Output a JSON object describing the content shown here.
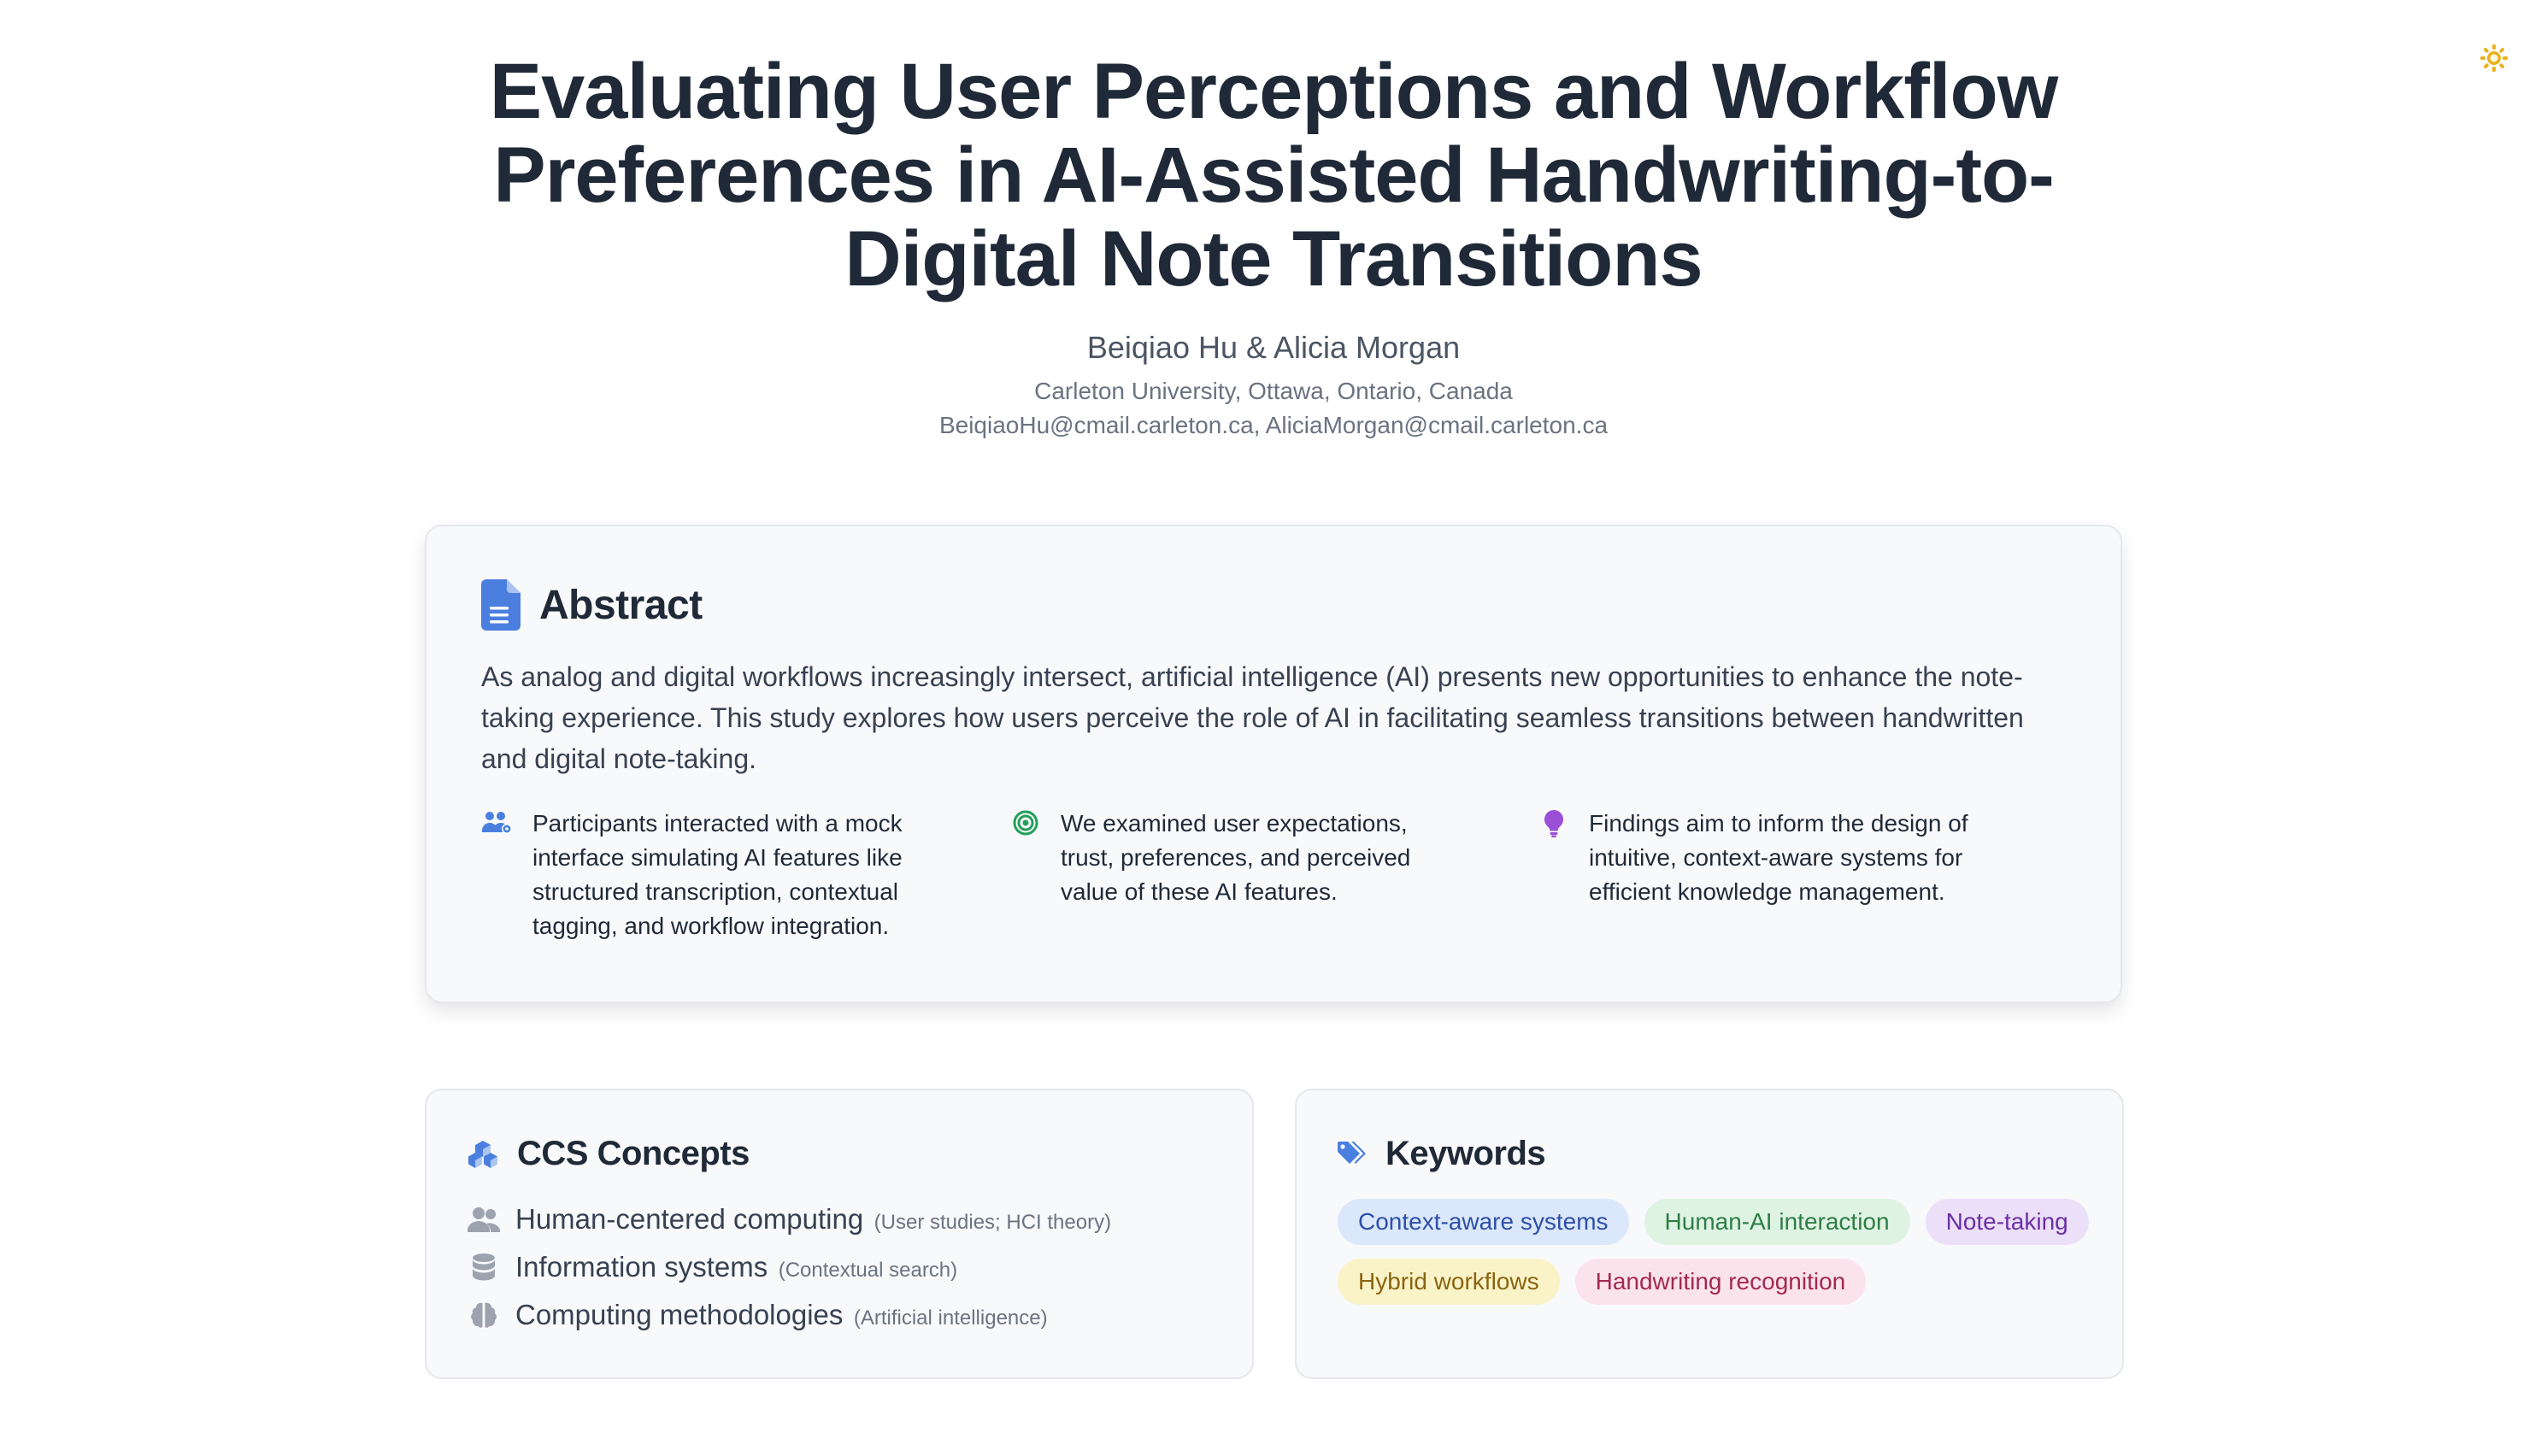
{
  "colors": {
    "accent_blue": "#4a7fe0",
    "accent_green": "#22a05a",
    "accent_purple": "#9b4fd6",
    "sun_yellow": "#e7b21d",
    "icon_gray": "#9ca3af"
  },
  "theme_toggle": {
    "icon": "sun-icon"
  },
  "header": {
    "title": "Evaluating User Perceptions and Workflow Preferences in AI-Assisted Handwriting-to-Digital Note Transitions",
    "authors": "Beiqiao Hu & Alicia Morgan",
    "affiliation": "Carleton University, Ottawa, Ontario, Canada",
    "emails": "BeiqiaoHu@cmail.carleton.ca, AliciaMorgan@cmail.carleton.ca"
  },
  "abstract": {
    "heading": "Abstract",
    "icon": "document-icon",
    "text": "As analog and digital workflows increasingly intersect, artificial intelligence (AI) presents new opportunities to enhance the note-taking experience. This study explores how users perceive the role of AI in facilitating seamless transitions between handwritten and digital note-taking.",
    "findings": [
      {
        "icon": "users-icon",
        "text": "Participants interacted with a mock interface simulating AI features like structured transcription, contextual tagging, and workflow integration."
      },
      {
        "icon": "target-icon",
        "text": "We examined user expectations, trust, preferences, and perceived value of these AI features."
      },
      {
        "icon": "lightbulb-icon",
        "text": "Findings aim to inform the design of intuitive, context-aware systems for efficient knowledge management."
      }
    ]
  },
  "ccs": {
    "heading": "CCS Concepts",
    "icon": "cubes-icon",
    "items": [
      {
        "icon": "user-group-icon",
        "label": "Human-centered computing",
        "detail": "(User studies; HCI theory)"
      },
      {
        "icon": "database-icon",
        "label": "Information systems",
        "detail": "(Contextual search)"
      },
      {
        "icon": "brain-icon",
        "label": "Computing methodologies",
        "detail": "(Artificial intelligence)"
      }
    ]
  },
  "keywords": {
    "heading": "Keywords",
    "icon": "tags-icon",
    "items": [
      "Context-aware systems",
      "Human-AI interaction",
      "Note-taking",
      "Hybrid workflows",
      "Handwriting recognition"
    ]
  }
}
